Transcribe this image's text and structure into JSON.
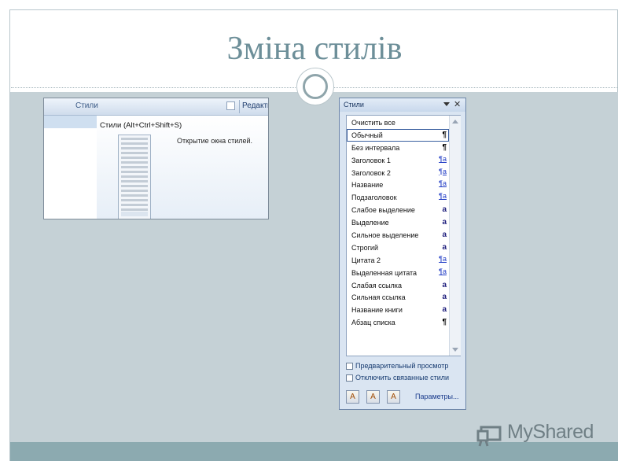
{
  "slide": {
    "title": "Зміна стилів"
  },
  "ribbon_shot": {
    "group_label": "Стили",
    "edit_label": "Редакти",
    "tooltip_title": "Стили (Alt+Ctrl+Shift+S)",
    "tooltip_desc": "Открытие окна стилей."
  },
  "styles_pane": {
    "title": "Стили",
    "items": [
      {
        "name": "Очистить все",
        "marker": ""
      },
      {
        "name": "Обычный",
        "marker": "¶"
      },
      {
        "name": "Без интервала",
        "marker": "¶"
      },
      {
        "name": "Заголовок 1",
        "marker": "¶a"
      },
      {
        "name": "Заголовок 2",
        "marker": "¶a"
      },
      {
        "name": "Название",
        "marker": "¶a"
      },
      {
        "name": "Подзаголовок",
        "marker": "¶a"
      },
      {
        "name": "Слабое выделение",
        "marker": "a"
      },
      {
        "name": "Выделение",
        "marker": "a"
      },
      {
        "name": "Сильное выделение",
        "marker": "a"
      },
      {
        "name": "Строгий",
        "marker": "a"
      },
      {
        "name": "Цитата 2",
        "marker": "¶a"
      },
      {
        "name": "Выделенная цитата",
        "marker": "¶a"
      },
      {
        "name": "Слабая ссылка",
        "marker": "a"
      },
      {
        "name": "Сильная ссылка",
        "marker": "a"
      },
      {
        "name": "Название книги",
        "marker": "a"
      },
      {
        "name": "Абзац списка",
        "marker": "¶"
      }
    ],
    "preview_label": "Предварительный просмотр",
    "disable_linked_label": "Отключить связанные стили",
    "options_link": "Параметры..."
  },
  "watermark": {
    "text": "MyShared"
  }
}
